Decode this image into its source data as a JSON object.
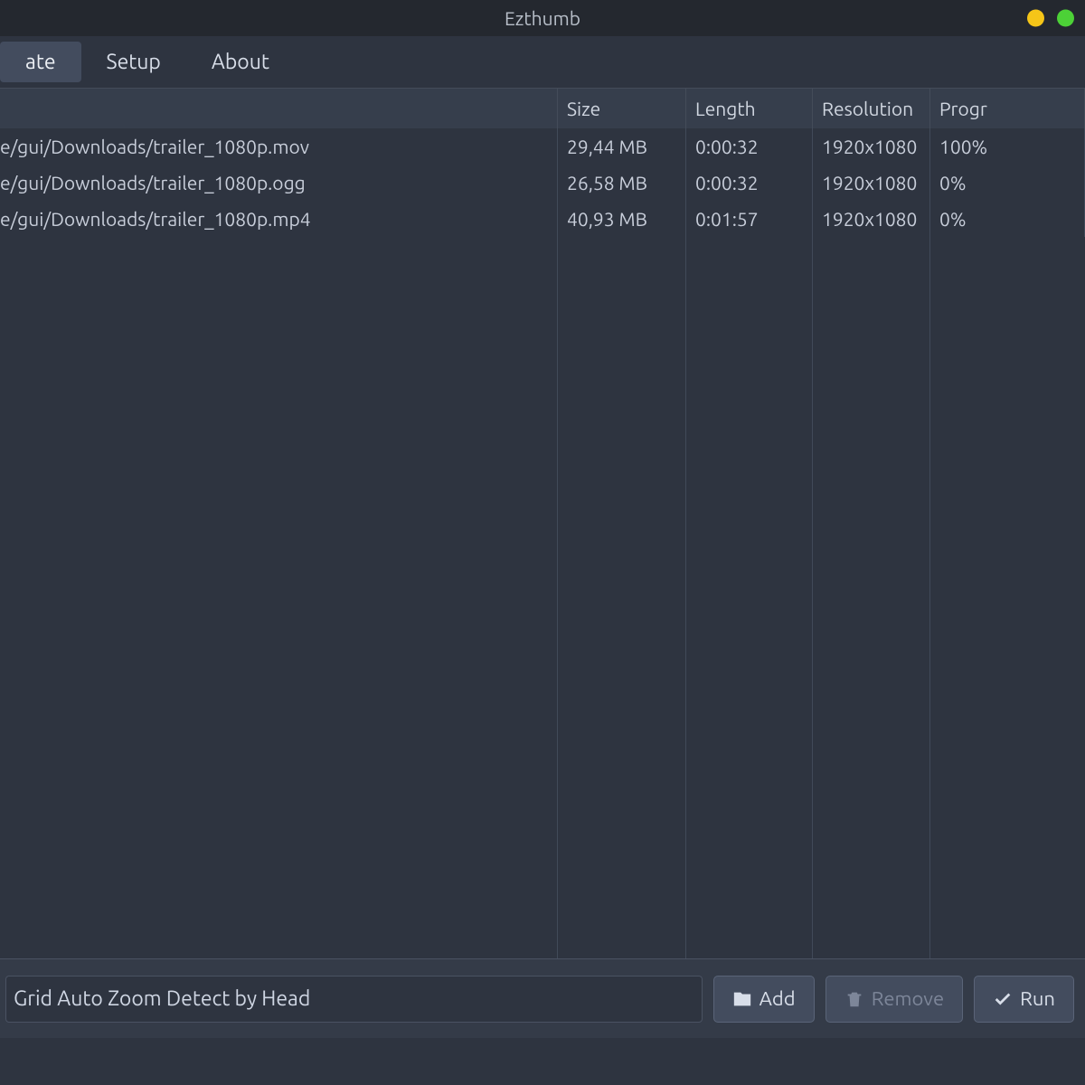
{
  "window": {
    "title": "Ezthumb"
  },
  "menu": {
    "items": [
      {
        "label": "ate",
        "active": true
      },
      {
        "label": "Setup",
        "active": false
      },
      {
        "label": "About",
        "active": false
      }
    ]
  },
  "table": {
    "headers": {
      "file": "",
      "size": "Size",
      "length": "Length",
      "resolution": "Resolution",
      "progress": "Progr"
    },
    "rows": [
      {
        "file": "e/gui/Downloads/trailer_1080p.mov",
        "size": "29,44 MB",
        "length": "0:00:32",
        "resolution": "1920x1080",
        "progress": "100%"
      },
      {
        "file": "e/gui/Downloads/trailer_1080p.ogg",
        "size": "26,58 MB",
        "length": "0:00:32",
        "resolution": "1920x1080",
        "progress": "0%"
      },
      {
        "file": "e/gui/Downloads/trailer_1080p.mp4",
        "size": "40,93 MB",
        "length": "0:01:57",
        "resolution": "1920x1080",
        "progress": "0%"
      }
    ]
  },
  "footer": {
    "status": "Grid Auto Zoom Detect by Head",
    "add_label": "Add",
    "remove_label": "Remove",
    "run_label": "Run"
  }
}
